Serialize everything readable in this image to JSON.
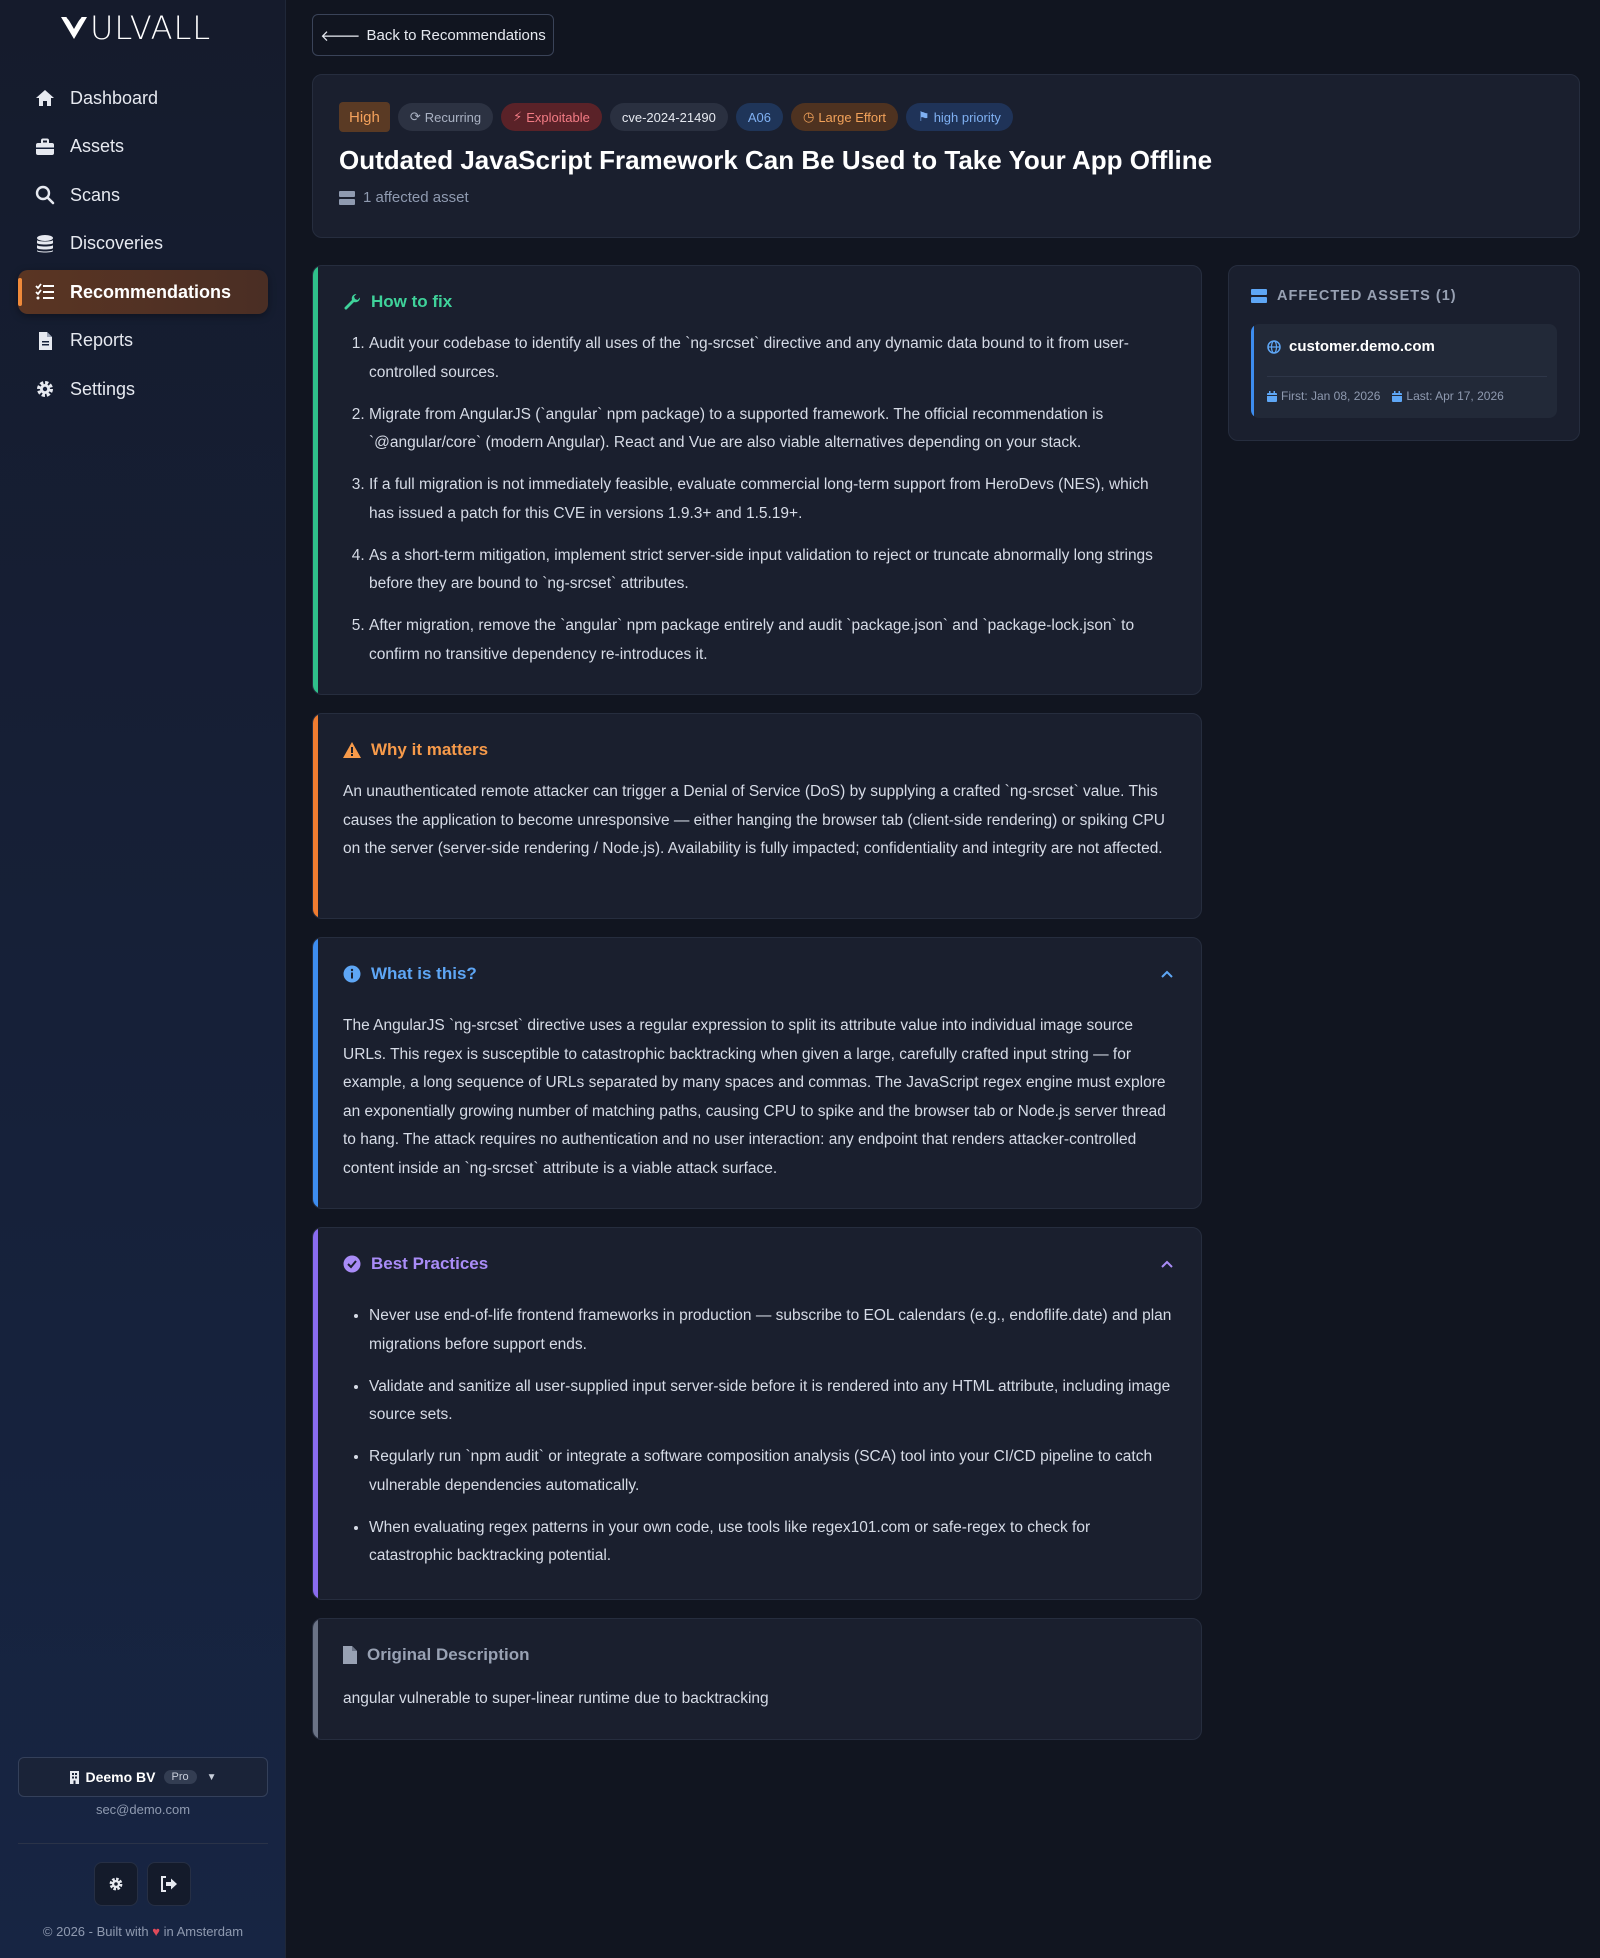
{
  "brand": {
    "name": "ULVALL"
  },
  "sidebar": {
    "items": [
      {
        "label": "Dashboard",
        "icon": "home-icon"
      },
      {
        "label": "Assets",
        "icon": "briefcase-icon"
      },
      {
        "label": "Scans",
        "icon": "search-icon"
      },
      {
        "label": "Discoveries",
        "icon": "database-icon"
      },
      {
        "label": "Recommendations",
        "icon": "list-check-icon",
        "active": true
      },
      {
        "label": "Reports",
        "icon": "file-icon"
      },
      {
        "label": "Settings",
        "icon": "gear-icon"
      }
    ],
    "org": {
      "name": "Deemo BV",
      "plan": "Pro",
      "email": "sec@demo.com"
    },
    "footer": {
      "prefix": "© 2026 - Built with",
      "suffix": "in Amsterdam"
    }
  },
  "back_button": {
    "label": "Back to Recommendations"
  },
  "header": {
    "badges": {
      "severity": "High",
      "recurring": "Recurring",
      "exploitable": "Exploitable",
      "cve": "cve-2024-21490",
      "owasp": "A06",
      "effort": "Large Effort",
      "priority": "high priority"
    },
    "title": "Outdated JavaScript Framework Can Be Used to Take Your App Offline",
    "affected": "1 affected asset"
  },
  "how_to_fix": {
    "title": "How to fix",
    "steps": [
      "Audit your codebase to identify all uses of the `ng-srcset` directive and any dynamic data bound to it from user-controlled sources.",
      "Migrate from AngularJS (`angular` npm package) to a supported framework. The official recommendation is `@angular/core` (modern Angular). React and Vue are also viable alternatives depending on your stack.",
      "If a full migration is not immediately feasible, evaluate commercial long-term support from HeroDevs (NES), which has issued a patch for this CVE in versions 1.9.3+ and 1.5.19+.",
      "As a short-term mitigation, implement strict server-side input validation to reject or truncate abnormally long strings before they are bound to `ng-srcset` attributes.",
      "After migration, remove the `angular` npm package entirely and audit `package.json` and `package-lock.json` to confirm no transitive dependency re-introduces it."
    ]
  },
  "why_it_matters": {
    "title": "Why it matters",
    "text": "An unauthenticated remote attacker can trigger a Denial of Service (DoS) by supplying a crafted `ng-srcset` value. This causes the application to become unresponsive — either hanging the browser tab (client-side rendering) or spiking CPU on the server (server-side rendering / Node.js). Availability is fully impacted; confidentiality and integrity are not affected."
  },
  "what_is_this": {
    "title": "What is this?",
    "text": "The AngularJS `ng-srcset` directive uses a regular expression to split its attribute value into individual image source URLs. This regex is susceptible to catastrophic backtracking when given a large, carefully crafted input string — for example, a long sequence of URLs separated by many spaces and commas. The JavaScript regex engine must explore an exponentially growing number of matching paths, causing CPU to spike and the browser tab or Node.js server thread to hang. The attack requires no authentication and no user interaction: any endpoint that renders attacker-controlled content inside an `ng-srcset` attribute is a viable attack surface."
  },
  "best_practices": {
    "title": "Best Practices",
    "items": [
      "Never use end-of-life frontend frameworks in production — subscribe to EOL calendars (e.g., endoflife.date) and plan migrations before support ends.",
      "Validate and sanitize all user-supplied input server-side before it is rendered into any HTML attribute, including image source sets.",
      "Regularly run `npm audit` or integrate a software composition analysis (SCA) tool into your CI/CD pipeline to catch vulnerable dependencies automatically.",
      "When evaluating regex patterns in your own code, use tools like regex101.com or safe-regex to check for catastrophic backtracking potential."
    ]
  },
  "original_description": {
    "title": "Original Description",
    "text": "angular vulnerable to super-linear runtime due to backtracking"
  },
  "affected_assets": {
    "title": "AFFECTED ASSETS (1)",
    "items": [
      {
        "host": "customer.demo.com",
        "first": "First: Jan 08, 2026",
        "last": "Last: Apr 17, 2026"
      }
    ]
  },
  "colors": {
    "accent": "#f08a3a",
    "fix": "#2fc08a",
    "why": "#f07c30",
    "what": "#3d8df0",
    "best": "#8a6cf0"
  }
}
